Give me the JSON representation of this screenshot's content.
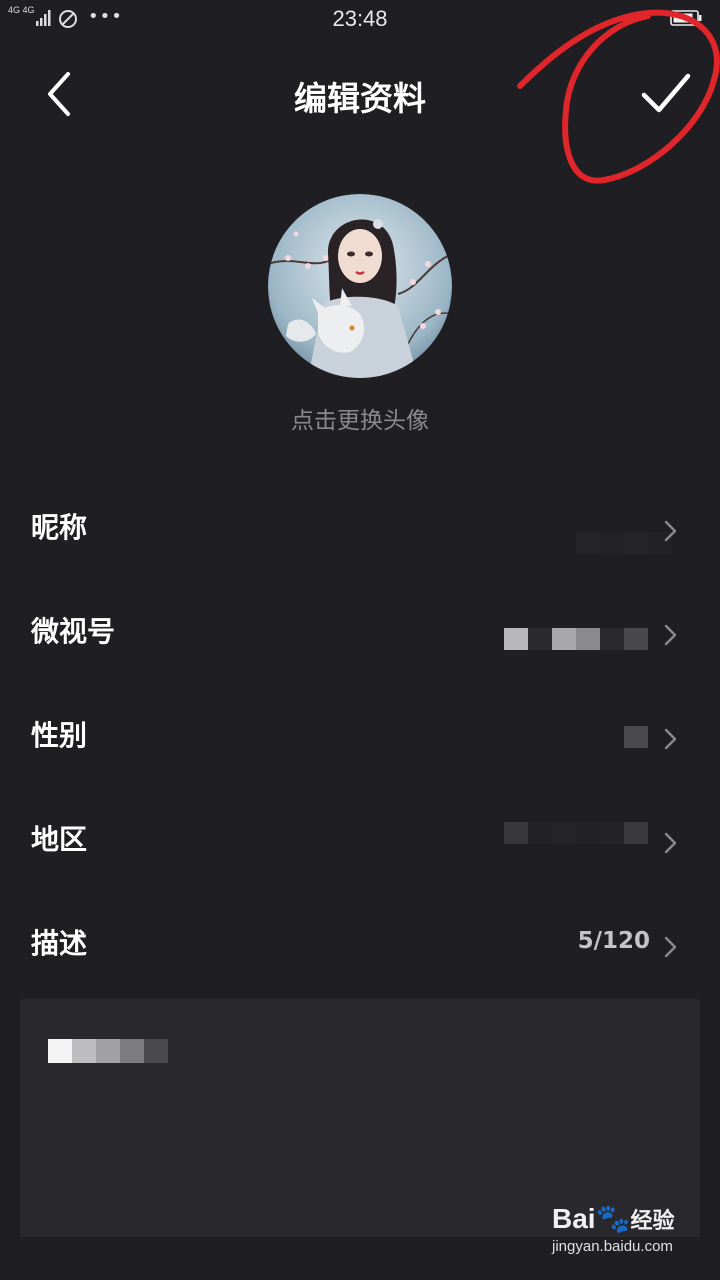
{
  "status_bar": {
    "network": "4G 4G",
    "time": "23:48"
  },
  "nav": {
    "title": "编辑资料"
  },
  "profile": {
    "avatar_hint": "点击更换头像"
  },
  "fields": [
    {
      "label": "昵称",
      "value": ""
    },
    {
      "label": "微视号",
      "value": ""
    },
    {
      "label": "性别",
      "value": ""
    },
    {
      "label": "地区",
      "value": ""
    },
    {
      "label": "描述",
      "value": "5/120"
    }
  ],
  "watermark": {
    "brand": "Bai",
    "brand_suffix": "经验",
    "url": "jingyan.baidu.com"
  },
  "colors": {
    "background": "#1f1e22",
    "annotation": "#e0262b"
  }
}
